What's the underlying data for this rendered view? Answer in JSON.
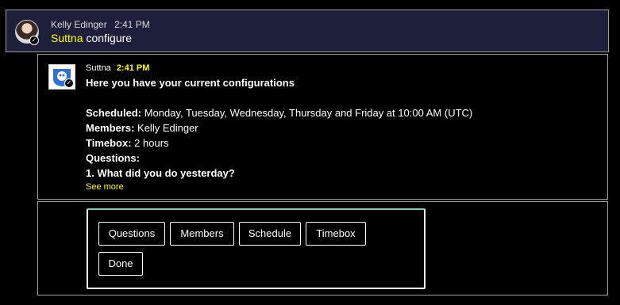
{
  "user_message": {
    "sender": "Kelly Edinger",
    "time": "2:41 PM",
    "mention": "Suttna",
    "command": "configure"
  },
  "bot_message": {
    "sender": "Suttna",
    "time": "2:41 PM",
    "heading": "Here you have your current configurations",
    "scheduled_label": "Scheduled:",
    "scheduled_value": " Monday, Tuesday, Wednesday, Thursday and Friday at 10:00 AM (UTC)",
    "members_label": "Members:",
    "members_value": " Kelly Edinger",
    "timebox_label": "Timebox:",
    "timebox_value": " 2 hours",
    "questions_label": "Questions:",
    "question_1": "1. What did you do yesterday?",
    "see_more": "See more"
  },
  "actions": {
    "questions": "Questions",
    "members": "Members",
    "schedule": "Schedule",
    "timebox": "Timebox",
    "done": "Done"
  },
  "colors": {
    "background": "#000000",
    "user_message_bg": "#1e1f3a",
    "highlight": "#ffff00",
    "card_accent": "#6ed3b8"
  },
  "icons": {
    "user_avatar": "avatar",
    "bot_avatar": "suttna-bot-icon",
    "status_badge": "check-circle-icon"
  }
}
